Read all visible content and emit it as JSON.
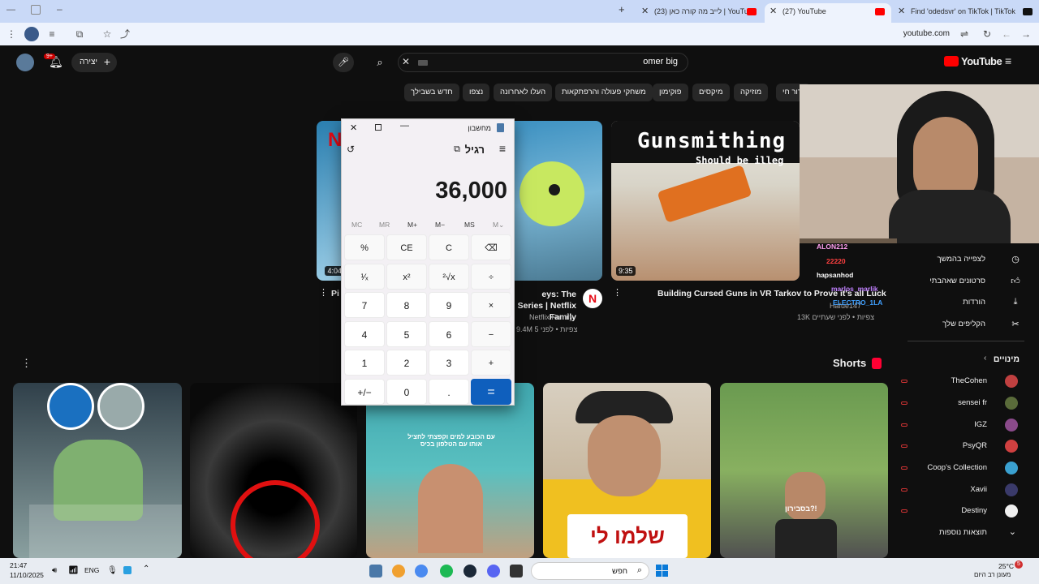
{
  "browser": {
    "tabs": [
      {
        "label": "Find 'odedsvr' on TikTok | TikTok"
      },
      {
        "label": "(27) YouTube"
      },
      {
        "label": "(23) לייב מה קורה כאן | YouTube"
      }
    ],
    "url": "youtube.com"
  },
  "youtube": {
    "logo": "YouTube",
    "search_value": "omer big",
    "create_label": "יצירה",
    "notif_count": "9+",
    "chips": [
      "ידור חי",
      "מוזיקה",
      "מיקסים",
      "פוקימון",
      "משחקי פעולה והרפתקאות",
      "העלו לאחרונה",
      "נצפו",
      "חדש בשבילך"
    ],
    "videos": [
      {
        "title": "Pi",
        "duration": "4:04"
      },
      {
        "title": "eys: The Series | Netflix Family",
        "channel": "Netflix Family",
        "meta": "9.4M צפיות • לפני 5"
      },
      {
        "title": "Building Cursed Guns in VR Tarkov to Prove it's all Luck",
        "thumb_text": "Gunsmithing",
        "thumb_sub": "Should be illeg",
        "duration": "9:35",
        "channel": "Hafue147",
        "meta": "13K צפיות • לפני שעתיים"
      }
    ],
    "shorts_label": "Shorts",
    "sidebar": {
      "items": [
        {
          "label": "לצפייה בהמשך",
          "icon": "clock-icon"
        },
        {
          "label": "סרטונים שאהבתי",
          "icon": "thumb-up-icon"
        },
        {
          "label": "הורדות",
          "icon": "download-icon"
        },
        {
          "label": "הקליפים שלך",
          "icon": "scissors-icon"
        }
      ],
      "subs_title": "מינויים",
      "subs": [
        {
          "label": "TheCohen",
          "color": "#c04040"
        },
        {
          "label": "sensei fr",
          "color": "#5a6b3a"
        },
        {
          "label": "IGZ",
          "color": "#8a4a8a"
        },
        {
          "label": "PsyQR",
          "color": "#d04040"
        },
        {
          "label": "Coop's Collection",
          "color": "#3aa0d0"
        },
        {
          "label": "Xavii",
          "color": "#3a3a6a"
        },
        {
          "label": "Destiny",
          "color": "#f0f0f0"
        }
      ],
      "more_label": "תוצאות נוספות"
    }
  },
  "calculator": {
    "window_title": "מחשבון",
    "mode": "רגיל",
    "display": "36,000",
    "memory": [
      "MC",
      "MR",
      "M+",
      "M−",
      "MS",
      "M⌄"
    ],
    "rows": [
      [
        "%",
        "CE",
        "C",
        "⌫"
      ],
      [
        "¹⁄ₓ",
        "x²",
        "²√x",
        "÷"
      ],
      [
        "7",
        "8",
        "9",
        "×"
      ],
      [
        "4",
        "5",
        "6",
        "−"
      ],
      [
        "1",
        "2",
        "3",
        "+"
      ],
      [
        "+/−",
        "0",
        ".",
        "="
      ]
    ]
  },
  "webcam_chat": [
    {
      "user": "ALON212",
      "color": "#ff9ff0"
    },
    {
      "user": "22220",
      "color": "#ff4040"
    },
    {
      "user": "hapsanhod",
      "color": "#ffffff"
    },
    {
      "user": "marlos_marlik",
      "color": "#c080ff"
    },
    {
      "user": "ELECTRO_1LA",
      "color": "#40a0ff"
    }
  ],
  "shorts_captions": [
    "עם הכובע למים וקפצתי לחציל אותו עם הטלפון בכיס",
    "בסבירון?!",
    "שלמו לי"
  ],
  "taskbar": {
    "search_label": "חפש",
    "time": "21:47",
    "date": "11/10/2025",
    "lang": "ENG",
    "weather_temp": "25°C",
    "weather_desc": "מעונן רב היום",
    "notif_badge": "5"
  }
}
